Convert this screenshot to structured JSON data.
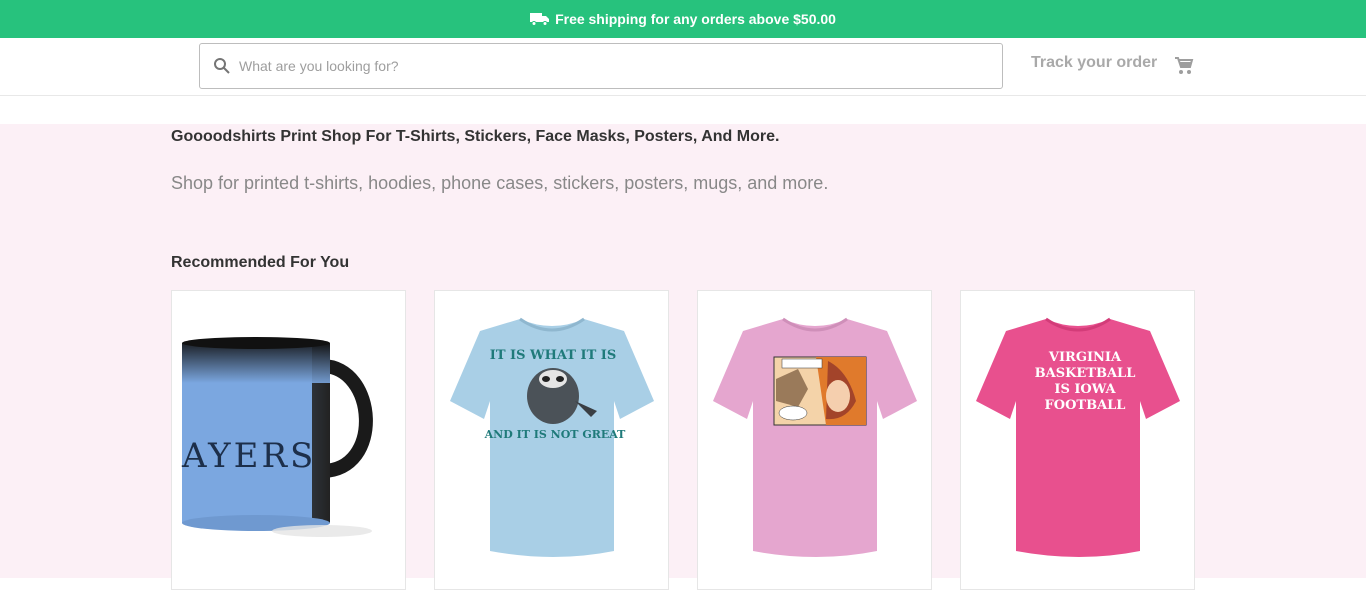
{
  "promo": {
    "text": "Free shipping for any orders above $50.00",
    "icon": "truck-icon"
  },
  "header": {
    "search_placeholder": "What are you looking for?",
    "track_label": "Track your order",
    "cart_icon": "cart-icon"
  },
  "hero": {
    "title": "Goooodshirts Print Shop For T-Shirts, Stickers, Face Masks, Posters, And More.",
    "subtitle": "Shop for printed t-shirts, hoodies, phone cases, stickers, posters, mugs, and more."
  },
  "recommended": {
    "title": "Recommended For You",
    "products": [
      {
        "type": "mug",
        "print": "AYERS"
      },
      {
        "type": "tshirt",
        "print_top": "IT IS WHAT IT IS",
        "print_bottom": "AND IT IS NOT GREAT"
      },
      {
        "type": "tshirt",
        "print_top": ""
      },
      {
        "type": "tshirt",
        "print_lines": [
          "VIRGINIA",
          "BASKETBALL",
          "IS IOWA",
          "FOOTBALL"
        ]
      }
    ]
  },
  "colors": {
    "promo_bg": "#27c27d",
    "hero_bg": "#fcf0f6",
    "shirt_light_blue": "#a9cfe6",
    "shirt_pink": "#e5a6cf",
    "shirt_hot_pink": "#e8508e",
    "mug_blue": "#7ba7e0"
  }
}
